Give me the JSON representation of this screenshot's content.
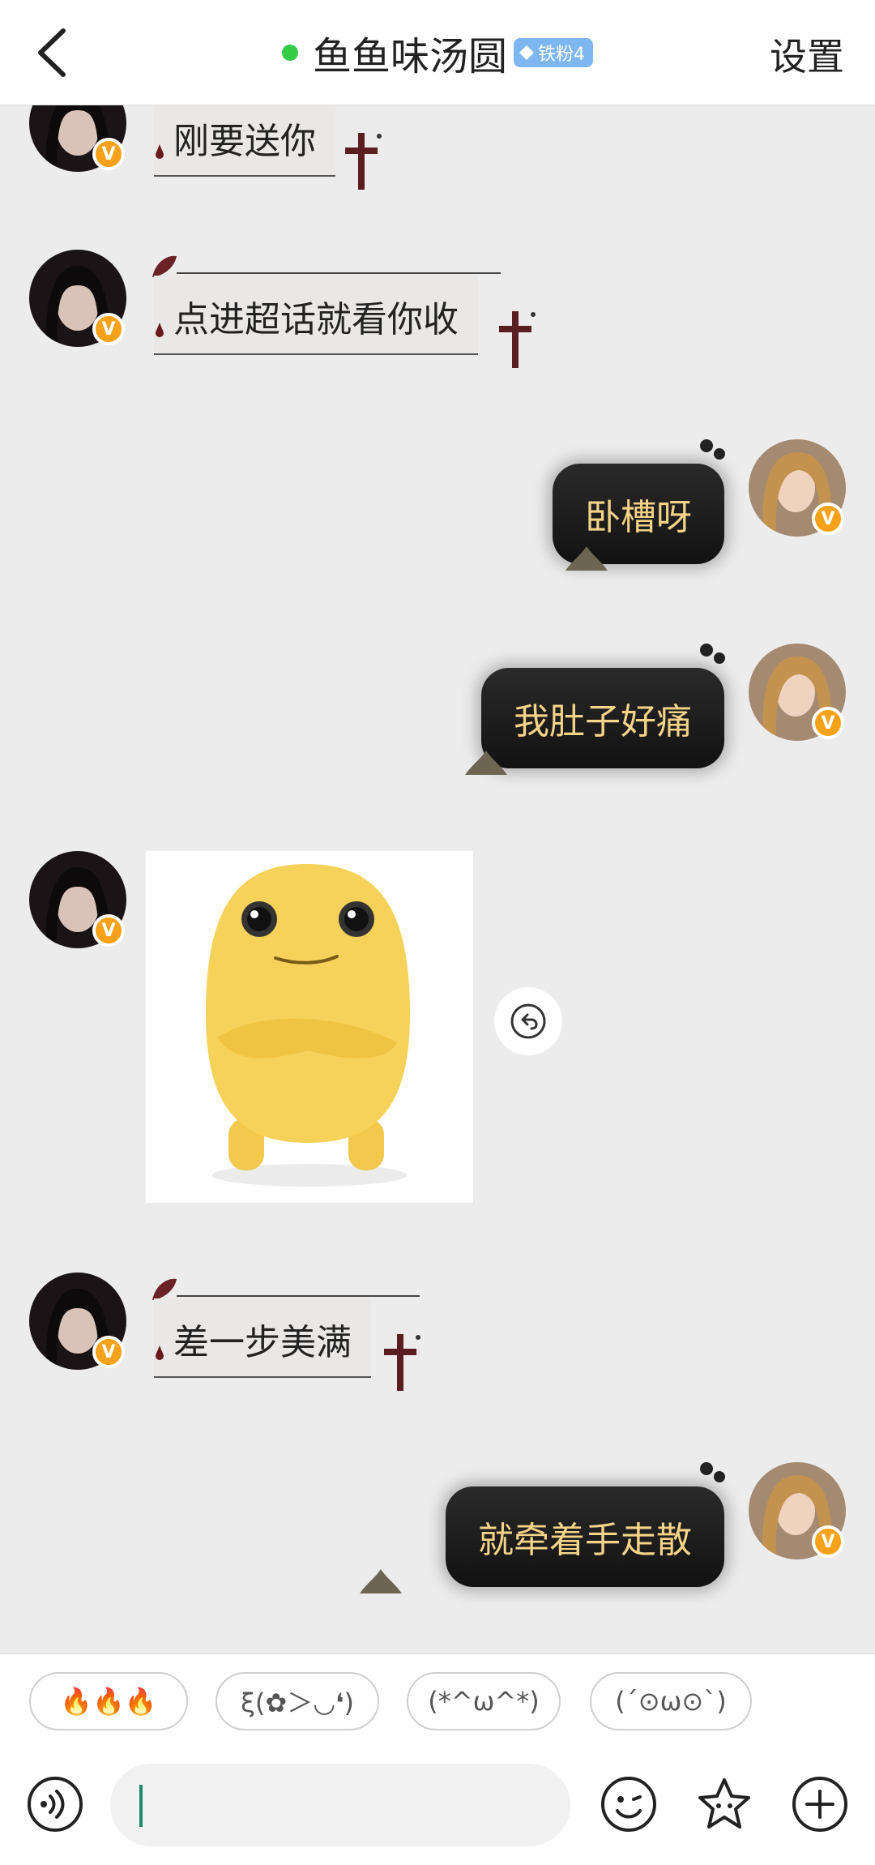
{
  "header": {
    "back_icon": "chevron-left-icon",
    "title": "鱼鱼味汤圆",
    "online_color": "#33cc44",
    "fan_badge": "铁粉4",
    "settings_label": "设置"
  },
  "messages": [
    {
      "side": "left",
      "style": "gothic",
      "text": "刚要送你"
    },
    {
      "side": "left",
      "style": "gothic",
      "text": "点进超话就看你收"
    },
    {
      "side": "right",
      "style": "dark",
      "text": "卧槽呀"
    },
    {
      "side": "right",
      "style": "dark",
      "text": "我肚子好痛"
    },
    {
      "side": "left",
      "style": "sticker",
      "text": ""
    },
    {
      "side": "left",
      "style": "gothic",
      "text": "差一步美满"
    },
    {
      "side": "right",
      "style": "dark",
      "text": "就牵着手走散"
    }
  ],
  "quick_replies": [
    "🔥🔥🔥",
    "ξ(✿＞◡❛)",
    "(*^ω^*)",
    "(´⊙ω⊙`)"
  ],
  "input": {
    "placeholder": "",
    "value": ""
  },
  "colors": {
    "dark_bubble_text": "#f5d488",
    "vip_badge": "#f7a21a",
    "caret": "#1e8a6a"
  }
}
